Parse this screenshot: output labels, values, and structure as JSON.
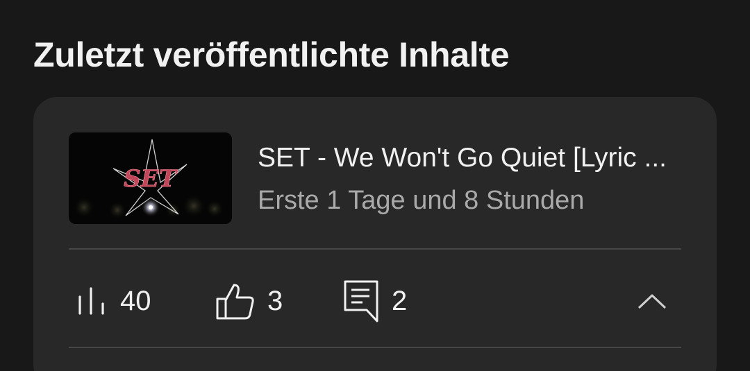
{
  "section": {
    "title": "Zuletzt veröffentlichte Inhalte"
  },
  "video": {
    "thumbnail_text": "SET",
    "title": "SET - We Won't Go Quiet [Lyric ...",
    "meta": "Erste 1 Tage und 8 Stunden"
  },
  "stats": {
    "views": "40",
    "likes": "3",
    "comments": "2"
  },
  "icons": {
    "views": "bar-chart-icon",
    "likes": "thumbs-up-icon",
    "comments": "comment-icon",
    "collapse": "chevron-up-icon"
  },
  "colors": {
    "background": "#181818",
    "card": "#282828",
    "primary_text": "#f1f1f1",
    "secondary_text": "#aaaaaa",
    "thumbnail_logo": "#c0465a"
  }
}
